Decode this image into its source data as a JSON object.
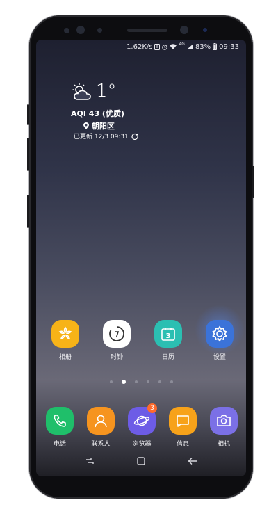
{
  "status_bar": {
    "network_speed": "1.62K/s",
    "network_type": "4G",
    "battery": "83%",
    "time": "09:33"
  },
  "weather": {
    "temperature": "1°",
    "aqi": "AQI 43 (优质)",
    "location": "朝阳区",
    "updated": "已更新 12/3 09:31"
  },
  "home_apps": [
    {
      "label": "相册",
      "icon": "gallery-icon",
      "color": "#f7b318"
    },
    {
      "label": "时钟",
      "icon": "clock-icon",
      "color": "#ffffff"
    },
    {
      "label": "日历",
      "icon": "calendar-icon",
      "color": "#2bbfb2",
      "date": "3"
    },
    {
      "label": "设置",
      "icon": "settings-gear-icon",
      "color": "#3b73d9"
    }
  ],
  "page_indicator": {
    "pages": 6,
    "active": 1
  },
  "dock_apps": [
    {
      "label": "电话",
      "icon": "phone-icon",
      "color": "#1fbf6a"
    },
    {
      "label": "联系人",
      "icon": "contacts-icon",
      "color": "#f6941f"
    },
    {
      "label": "浏览器",
      "icon": "browser-icon",
      "color": "#6d5ce6",
      "badge": "3"
    },
    {
      "label": "信息",
      "icon": "messages-icon",
      "color": "#f7a21a"
    },
    {
      "label": "相机",
      "icon": "camera-icon",
      "color": "#7b70e6"
    }
  ],
  "navigation": [
    "recent-apps-icon",
    "home-icon",
    "back-icon"
  ]
}
